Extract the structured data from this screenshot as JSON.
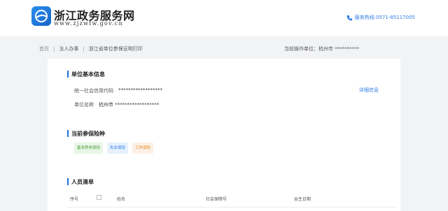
{
  "header": {
    "title": "浙江政务服务网",
    "url": "www.zjzwfw.gov.cn",
    "hotline": "服务热线:0571-85117005"
  },
  "breadcrumb": {
    "items": [
      "首页",
      "法人办事",
      "浙江省单位参保证明打印"
    ],
    "operator": "当前操作单位：杭州市 **********"
  },
  "unit_info": {
    "title": "单位基本信息",
    "credit_code_label": "统一社会信用代码",
    "credit_code_value": "******************",
    "name_label": "单位名称",
    "name_value": "杭州市 ******************",
    "detail_link": "详细信息"
  },
  "insurance": {
    "title": "当前参保险种",
    "tags": [
      "基本养老保险",
      "失业保险",
      "工伤保险"
    ],
    "colors": {
      "pension": "#4a9e3a",
      "unemployment": "#2c7be5",
      "injury": "#e08a2c"
    }
  },
  "personnel": {
    "title": "人员清单",
    "columns": [
      "序号",
      "姓名",
      "社会保障号",
      "出生日期"
    ]
  },
  "colors": {
    "accent": "#1e6fd9",
    "link": "#2c7be5"
  }
}
